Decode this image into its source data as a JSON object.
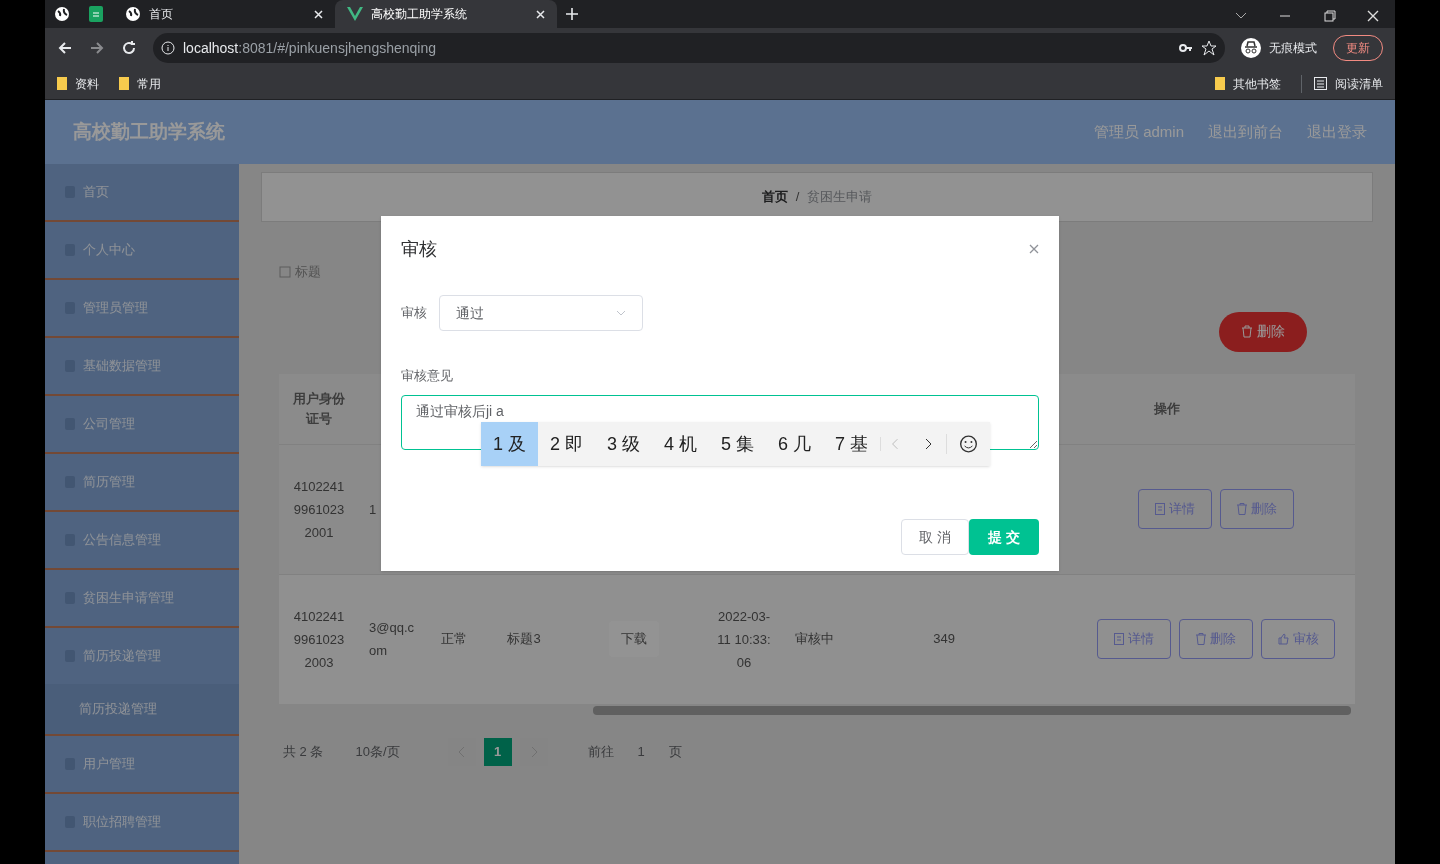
{
  "browser": {
    "tabs": [
      {
        "kind": "icon",
        "selected": false
      },
      {
        "kind": "sheet",
        "selected": false
      },
      {
        "kind": "page",
        "title": "首页",
        "selected": false
      },
      {
        "kind": "app",
        "title": "高校勤工助学系统",
        "selected": true
      }
    ],
    "address_host": "localhost",
    "address_rest": ":8081/#/pinkuensjhengshenqing",
    "bookmarks": [
      "资料",
      "常用"
    ],
    "profile": "无痕模式",
    "update": "更新",
    "other_bookmarks": "其他书签",
    "reading_list": "阅读清单"
  },
  "app": {
    "title": "高校勤工助学系统",
    "header_links": [
      "管理员 admin",
      "退出到前台",
      "退出登录"
    ],
    "sidebar": [
      {
        "label": "首页"
      },
      {
        "label": "个人中心"
      },
      {
        "label": "管理员管理"
      },
      {
        "label": "基础数据管理"
      },
      {
        "label": "公司管理"
      },
      {
        "label": "简历管理"
      },
      {
        "label": "公告信息管理"
      },
      {
        "label": "贫困生申请管理"
      },
      {
        "label": "简历投递管理",
        "children": [
          {
            "label": "简历投递管理"
          }
        ]
      },
      {
        "label": "用户管理"
      },
      {
        "label": "职位招聘管理"
      }
    ],
    "breadcrumb": [
      "首页",
      "贫困生申请"
    ],
    "breadcrumb_separator": "/",
    "search_label": "标题",
    "delete_button": "删除",
    "table": {
      "id_header": "用户身份证号",
      "actions_header": "操作",
      "rows": [
        {
          "cells": [
            "410224199610232001",
            "1"
          ],
          "actions": [
            "详情",
            "删除"
          ]
        },
        {
          "cells": [
            "410224199610232003",
            "3@qq.com",
            "正常",
            "标题3",
            "下载",
            "2022-03-11 10:33:06",
            "审核中",
            "349"
          ],
          "actions": [
            "详情",
            "删除",
            "审核"
          ]
        }
      ]
    },
    "pagination": {
      "total": "共 2 条",
      "page_size": "10条/页",
      "pages": [
        {
          "label": "1",
          "selected": true
        }
      ],
      "goto": "前往",
      "goto_value": "1",
      "page_unit": "页"
    }
  },
  "dialog": {
    "title": "审核",
    "status_label": "审核",
    "status_value": "通过",
    "opinion_label": "审核意见",
    "opinion_value": "通过审核后ji a",
    "cancel": "取 消",
    "submit": "提 交"
  },
  "ime": {
    "candidates": [
      {
        "label": "1 及",
        "selected": true
      },
      {
        "label": "2 即",
        "selected": false
      },
      {
        "label": "3 级",
        "selected": false
      },
      {
        "label": "4 机",
        "selected": false
      },
      {
        "label": "5 集",
        "selected": false
      },
      {
        "label": "6 几",
        "selected": false
      },
      {
        "label": "7 基",
        "selected": false
      }
    ]
  }
}
